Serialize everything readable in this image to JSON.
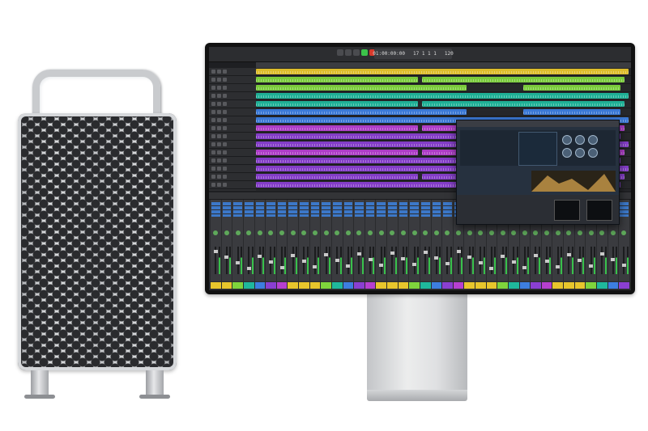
{
  "scene": {
    "subject_left": "mac-pro-tower",
    "subject_right": "pro-display-with-logic-pro"
  },
  "colors": {
    "background": "#ffffff",
    "tower_silver": "#c9cbce",
    "screen_bg": "#1e1f22",
    "region_yellow": "#e8c62c",
    "region_green": "#7fd43c",
    "region_teal": "#1fb89c",
    "region_blue": "#3d7ee0",
    "region_purple": "#8a3fd1",
    "region_magenta": "#b63fd0",
    "play_green": "#3cc24a",
    "record_red": "#d8392b"
  },
  "logic": {
    "lcd_left": "01:00:00:00",
    "lcd_mid": "17 1 1 1",
    "lcd_right": "120"
  }
}
